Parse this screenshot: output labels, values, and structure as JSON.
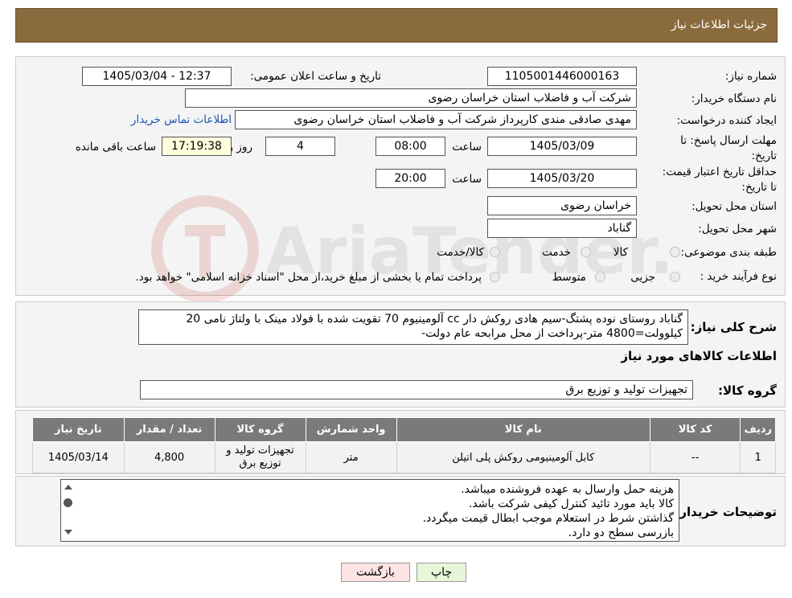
{
  "header": {
    "title": "جزئیات اطلاعات نیاز"
  },
  "form": {
    "need_number_label": "شماره نیاز:",
    "need_number": "1105001446000163",
    "announce_label": "تاریخ و ساعت اعلان عمومی:",
    "announce_value": "1405/03/04 - 12:37",
    "buyer_org_label": "نام دستگاه خریدار:",
    "buyer_org": "شرکت آب و فاضلاب استان خراسان رضوی",
    "requester_label": "ایجاد کننده درخواست:",
    "requester": "مهدی صادقی مندی کارپرداز شرکت آب و فاضلاب استان خراسان رضوی",
    "contact_link": "اطلاعات تماس خریدار",
    "reply_deadline_label": "مهلت ارسال پاسخ: تا تاریخ:",
    "reply_date": "1405/03/09",
    "time_label": "ساعت",
    "reply_time": "08:00",
    "days_value": "4",
    "days_label": "روز و",
    "remaining_time": "17:19:38",
    "remaining_label": "ساعت باقی مانده",
    "price_validity_label": "حداقل تاریخ اعتبار قیمت: تا تاریخ:",
    "price_date": "1405/03/20",
    "price_time": "20:00",
    "province_label": "استان محل تحویل:",
    "province": "خراسان رضوی",
    "city_label": "شهر محل تحویل:",
    "city": "گناباد",
    "category_label": "طبقه بندی موضوعی:",
    "category_options": [
      "کالا",
      "خدمت",
      "کالا/خدمت"
    ],
    "process_label": "نوع فرآیند خرید :",
    "process_options": [
      "جزیی",
      "متوسط"
    ],
    "process_note": "پرداخت تمام یا بخشی از مبلغ خرید،از محل \"اسناد خزانه اسلامی\" خواهد بود."
  },
  "summary": {
    "label": "شرح کلی نیاز:",
    "line1": "گناباد روستای نوده پشتگ-سیم هادی روکش دار cc آلومینیوم 70 تقویت شده با فولاد مینک با ولتاژ نامی 20",
    "line2": "کیلوولت=4800 متر-پرداخت از محل مرابحه عام دولت-",
    "goods_info_title": "اطلاعات کالاهای مورد نیاز",
    "goods_group_label": "گروه کالا:",
    "goods_group": "تجهیزات تولید و توزیع برق"
  },
  "table": {
    "headers": [
      "ردیف",
      "کد کالا",
      "نام کالا",
      "واحد شمارش",
      "گروه کالا",
      "تعداد / مقدار",
      "تاریخ نیاز"
    ],
    "row": [
      "1",
      "--",
      "کابل آلومینیومی روکش پلی اتیلن",
      "متر",
      "تجهیزات تولید و توزیع برق",
      "4,800",
      "1405/03/14"
    ]
  },
  "buyer_notes": {
    "label": "توضیحات خریدار:",
    "lines": [
      "هزینه حمل وارسال به عهده فروشنده میباشد.",
      "کالا باید مورد تائید کنترل کیفی شرکت باشد.",
      "گذاشتن شرط در استعلام موجب ابطال قیمت میگردد.",
      "بازرسی سطح دو دارد."
    ]
  },
  "buttons": {
    "print": "چاپ",
    "back": "بازگشت"
  },
  "watermark": {
    "text": "AriaTender.neT"
  },
  "colors": {
    "header_bg": "#8a6b3d",
    "panel_bg": "#f4f4f4",
    "table_header": "#7a7a7a",
    "link": "#1a55b0",
    "print_btn": "#e6f7d9",
    "back_btn": "#fde3e3"
  }
}
